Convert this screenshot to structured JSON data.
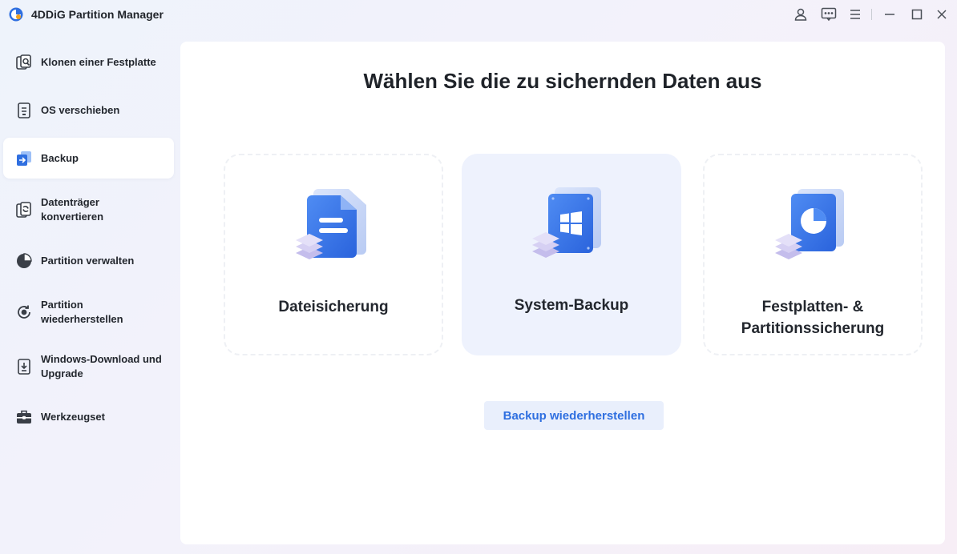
{
  "app": {
    "title": "4DDiG Partition Manager",
    "accent": "#2f6fe0"
  },
  "titlebar": {
    "buttons": [
      "account-icon",
      "feedback-icon",
      "menu-icon",
      "minimize-icon",
      "maximize-icon",
      "close-icon"
    ]
  },
  "sidebar": {
    "items": [
      {
        "label": "Klonen einer Festplatte",
        "icon": "clone-disk-icon"
      },
      {
        "label": "OS verschieben",
        "icon": "migrate-os-icon"
      },
      {
        "label": "Backup",
        "icon": "backup-icon",
        "active": true
      },
      {
        "label": "Datenträger konvertieren",
        "icon": "convert-disk-icon"
      },
      {
        "label": "Partition verwalten",
        "icon": "partition-pie-icon"
      },
      {
        "label": "Partition wiederherstellen",
        "icon": "recover-partition-icon"
      },
      {
        "label": "Windows-Download und Upgrade",
        "icon": "windows-download-icon"
      },
      {
        "label": "Werkzeugset",
        "icon": "toolbox-icon"
      }
    ]
  },
  "main": {
    "title": "Wählen Sie die zu sichernden Daten aus",
    "cards": [
      {
        "label": "Dateisicherung",
        "icon": "file-backup-icon"
      },
      {
        "label": "System-Backup",
        "icon": "system-backup-icon",
        "selected": true
      },
      {
        "label": "Festplatten- & Partitionssicherung",
        "icon": "disk-partition-backup-icon"
      }
    ],
    "restore_button": "Backup wiederherstellen"
  }
}
